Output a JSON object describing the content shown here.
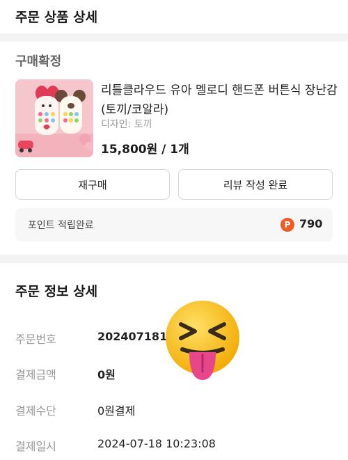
{
  "header": {
    "title": "주문 상품 상세"
  },
  "order": {
    "status": "구매확정",
    "product": {
      "name": "리틀클라우드 유아 멜로디 핸드폰 버튼식 장난감 (토끼/코알라)",
      "option": "디자인: 토끼",
      "price": "15,800원 / 1개"
    },
    "buttons": {
      "rebuy": "재구매",
      "review": "리뷰 작성 완료"
    },
    "points": {
      "label": "포인트 적립완료",
      "icon_letter": "P",
      "value": "790"
    }
  },
  "info": {
    "title": "주문 정보 상세",
    "rows": [
      {
        "label": "주문번호",
        "value": "202407181"
      },
      {
        "label": "결제금액",
        "value": "0원"
      },
      {
        "label": "결제수단",
        "value": "0원결제"
      },
      {
        "label": "결제일시",
        "value": "2024-07-18 10:23:08"
      }
    ]
  },
  "colors": {
    "point_badge": "#f15a24",
    "emoji": "#f7b500",
    "tongue": "#e8468a"
  },
  "icons": {
    "point": "point-p-icon",
    "overlay": "squinting-tongue-emoji"
  }
}
